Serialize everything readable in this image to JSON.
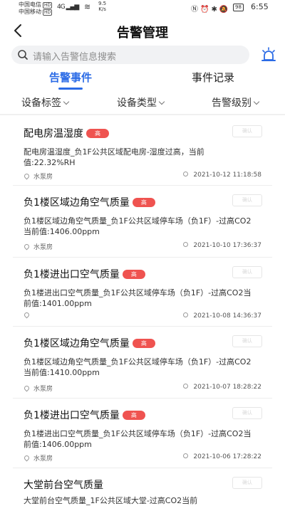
{
  "status_bar": {
    "carrier1": "中国电信",
    "carrier2": "中国移动",
    "hd_badge": "HD",
    "signal": "4G",
    "speed_value": "9.5",
    "speed_unit": "K/s",
    "battery": "98",
    "time": "6:55"
  },
  "header": {
    "title": "告警管理"
  },
  "search": {
    "placeholder": "请输入告警信息搜索"
  },
  "tabs": [
    {
      "label": "告警事件",
      "active": true
    },
    {
      "label": "事件记录",
      "active": false
    }
  ],
  "filters": [
    {
      "label": "设备标签"
    },
    {
      "label": "设备类型"
    },
    {
      "label": "告警级别"
    }
  ],
  "colors": {
    "accent": "#2b6be6",
    "alert_high": "#ef5350"
  },
  "alerts": [
    {
      "title": "配电房温湿度",
      "level": "高",
      "button": "确认",
      "description": "配电房温湿度_负1F公共区域配电房-湿度过高，当前值:22.32%RH",
      "location": "水泵房",
      "time": "2021-10-12 11:18:58"
    },
    {
      "title": "负1楼区域边角空气质量",
      "level": "高",
      "button": "确认",
      "description": "负1楼区域边角空气质量_负1F公共区域停车场（负1F）-过高CO2当前值:1406.00ppm",
      "location": "水泵房",
      "time": "2021-10-10 17:36:37"
    },
    {
      "title": "负1楼进出口空气质量",
      "level": "高",
      "button": "确认",
      "description": "负1楼进出口空气质量_负1F公共区域停车场（负1F）-过高CO2当前值:1401.00ppm",
      "location": "",
      "time": "2021-10-08 14:36:37"
    },
    {
      "title": "负1楼区域边角空气质量",
      "level": "高",
      "button": "确认",
      "description": "负1楼区域边角空气质量_负1F公共区域停车场（负1F）-过高CO2当前值:1410.00ppm",
      "location": "水泵房",
      "time": "2021-10-07 18:28:22"
    },
    {
      "title": "负1楼进出口空气质量",
      "level": "高",
      "button": "确认",
      "description": "负1楼进出口空气质量_负1F公共区域停车场（负1F）-过高CO2当前值:1406.00ppm",
      "location": "水泵房",
      "time": "2021-10-06 17:28:22"
    },
    {
      "title": "大堂前台空气质量",
      "level": "",
      "button": "确认",
      "description": "大堂前台空气质量_1F公共区域大堂-过高CO2当前",
      "location": "",
      "time": ""
    }
  ]
}
